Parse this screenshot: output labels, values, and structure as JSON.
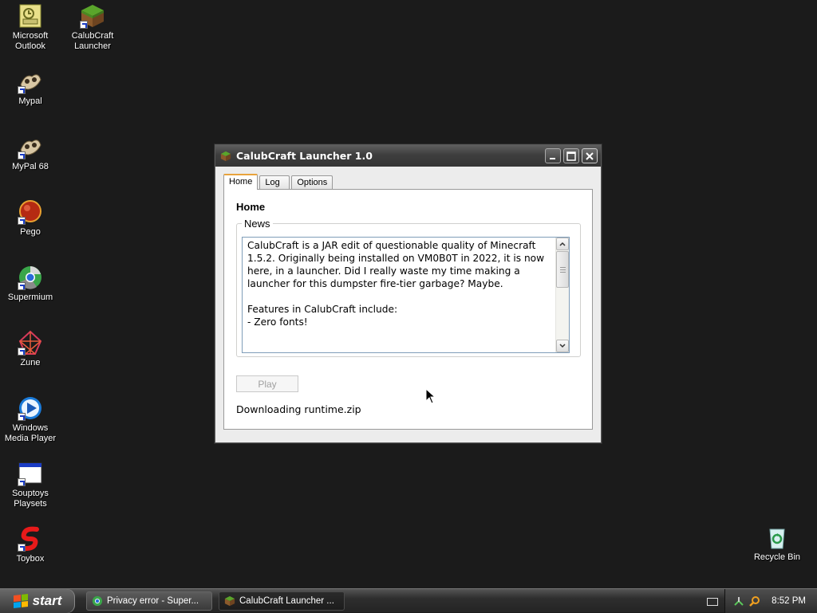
{
  "desktop": {
    "icons": [
      {
        "label": "Microsoft Outlook"
      },
      {
        "label": "CalubCraft Launcher"
      },
      {
        "label": "Mypal"
      },
      {
        "label": "MyPal 68"
      },
      {
        "label": "Pego"
      },
      {
        "label": "Supermium"
      },
      {
        "label": "Zune"
      },
      {
        "label": "Windows Media Player"
      },
      {
        "label": "Souptoys Playsets"
      },
      {
        "label": "Toybox"
      },
      {
        "label": "Recycle Bin"
      }
    ]
  },
  "window": {
    "title": "CalubCraft Launcher 1.0",
    "tabs": [
      {
        "label": "Home",
        "active": true
      },
      {
        "label": "Log",
        "active": false
      },
      {
        "label": "Options",
        "active": false
      }
    ],
    "heading": "Home",
    "news_legend": "News",
    "news_text": "CalubCraft is a JAR edit of questionable quality of Minecraft 1.5.2. Originally being installed on VM0B0T in 2022, it is now here, in a launcher. Did I really waste my time making a launcher for this dumpster fire-tier garbage? Maybe.\n\nFeatures in CalubCraft include:\n- Zero fonts!",
    "play_label": "Play",
    "status_text": "Downloading runtime.zip"
  },
  "taskbar": {
    "start_label": "start",
    "tasks": [
      {
        "label": "Privacy error - Super..."
      },
      {
        "label": "CalubCraft Launcher ..."
      }
    ],
    "clock": "8:52 PM"
  },
  "colors": {
    "desktop_bg": "#1b1b1b",
    "tab_accent": "#e8a33c",
    "textbox_border": "#7f9db9"
  }
}
